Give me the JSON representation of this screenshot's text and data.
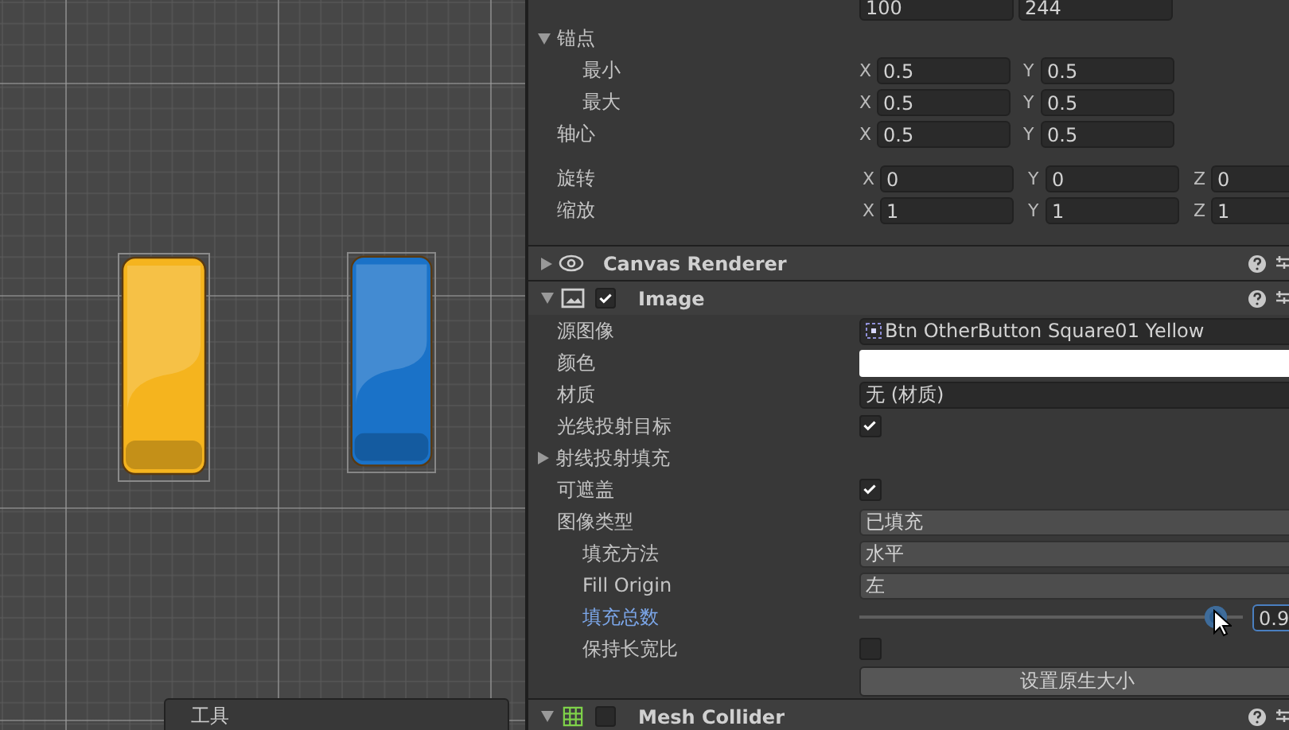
{
  "scene": {
    "sprites": [
      {
        "color": "#f5b41e"
      },
      {
        "color": "#1a72c8"
      }
    ],
    "tools_panel": {
      "title": "工具"
    }
  },
  "inspector": {
    "transform_rows": [
      {
        "kind": "vector2",
        "axes": [
          {
            "value": "100"
          },
          {
            "value": "244"
          }
        ]
      },
      {
        "kind": "foldout",
        "label": "锚点",
        "expanded": true,
        "children": [
          {
            "kind": "vector2",
            "label": "最小",
            "axes": [
              {
                "axis": "X",
                "value": "0.5"
              },
              {
                "axis": "Y",
                "value": "0.5"
              }
            ]
          },
          {
            "kind": "vector2",
            "label": "最大",
            "axes": [
              {
                "axis": "X",
                "value": "0.5"
              },
              {
                "axis": "Y",
                "value": "0.5"
              }
            ]
          }
        ]
      },
      {
        "kind": "vector2",
        "label": "轴心",
        "axes": [
          {
            "axis": "X",
            "value": "0.5"
          },
          {
            "axis": "Y",
            "value": "0.5"
          }
        ]
      },
      {
        "kind": "vector3",
        "label": "旋转",
        "axes": [
          {
            "axis": "X",
            "value": "0"
          },
          {
            "axis": "Y",
            "value": "0"
          },
          {
            "axis": "Z",
            "value": "0"
          }
        ]
      },
      {
        "kind": "vector3",
        "label": "缩放",
        "axes": [
          {
            "axis": "X",
            "value": "1"
          },
          {
            "axis": "Y",
            "value": "1"
          },
          {
            "axis": "Z",
            "value": "1"
          }
        ]
      }
    ],
    "components": [
      {
        "name": "Canvas Renderer",
        "expanded": false
      },
      {
        "name": "Image",
        "expanded": true,
        "enabled": true,
        "rows": [
          {
            "kind": "object",
            "label": "源图像",
            "value": "Btn OtherButton Square01 Yellow",
            "icon": true
          },
          {
            "kind": "color",
            "label": "颜色",
            "color": "#ffffff"
          },
          {
            "kind": "object",
            "label": "材质",
            "value": "无 (材质)"
          },
          {
            "kind": "checkbox",
            "label": "光线投射目标",
            "checked": true
          },
          {
            "kind": "foldout",
            "label": "射线投射填充",
            "expanded": false
          },
          {
            "kind": "checkbox",
            "label": "可遮盖",
            "checked": true
          },
          {
            "kind": "dropdown",
            "label": "图像类型",
            "value": "已填充",
            "children": [
              {
                "kind": "dropdown",
                "label": "填充方法",
                "value": "水平"
              },
              {
                "kind": "dropdown",
                "label": "Fill Origin",
                "value": "左"
              },
              {
                "kind": "slider",
                "label": "填充总数",
                "level": 0.93,
                "value": "0.9",
                "focused": true
              },
              {
                "kind": "checkbox",
                "label": "保持长宽比",
                "checked": false
              }
            ]
          },
          {
            "kind": "button",
            "label": "设置原生大小"
          }
        ]
      },
      {
        "name": "Mesh Collider",
        "expanded": true,
        "enabled": false
      }
    ]
  }
}
